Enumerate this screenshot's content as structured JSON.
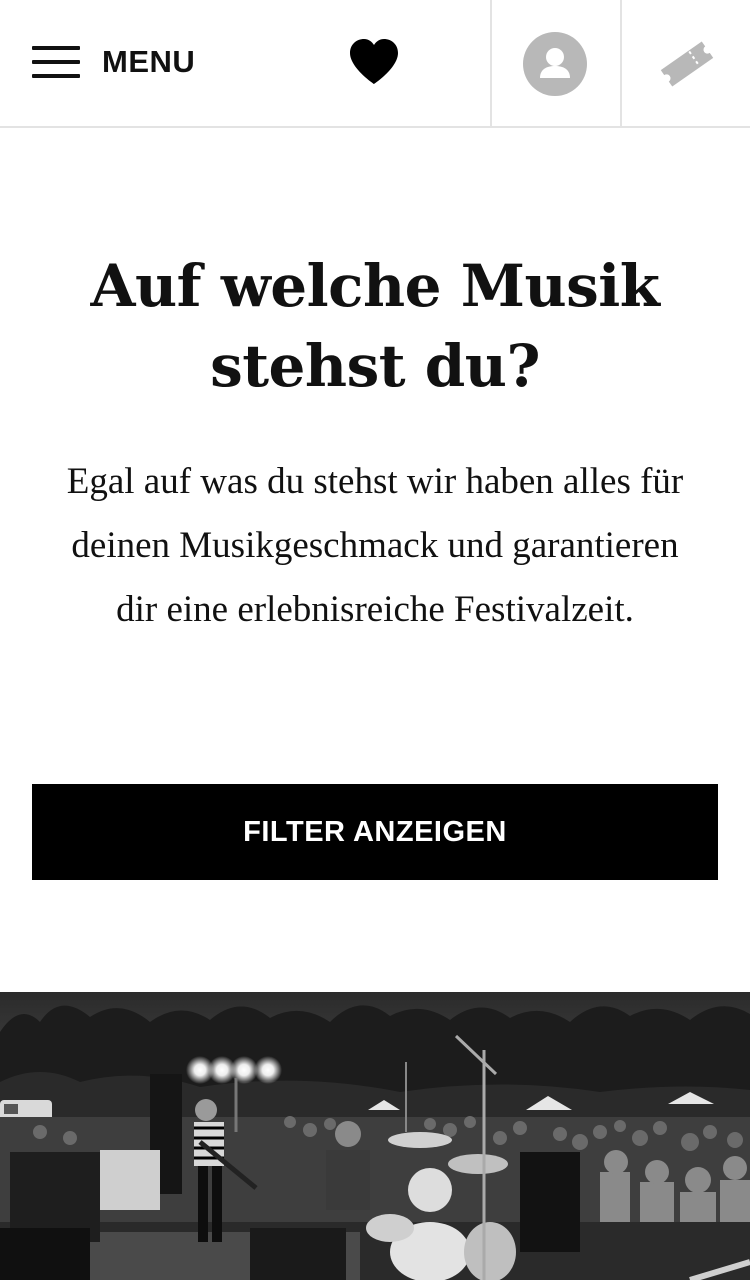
{
  "header": {
    "menu_label": "MENU",
    "icons": {
      "menu": "hamburger-menu-icon",
      "favorites": "heart-icon",
      "account": "user-avatar-icon",
      "tickets": "ticket-icon"
    }
  },
  "hero": {
    "headline": "Auf welche Musik stehst du?",
    "intro": "Egal auf was du stehst wir haben alles für deinen Musikgeschmack und garantieren dir eine erlebnisreiche Festivalzeit.",
    "filter_button_label": "FILTER ANZEIGEN"
  },
  "colors": {
    "background": "#ffffff",
    "text": "#111111",
    "button": "#000000",
    "button_text": "#ffffff",
    "icon_gray": "#b8b8b8",
    "divider": "#e3e3e3"
  }
}
